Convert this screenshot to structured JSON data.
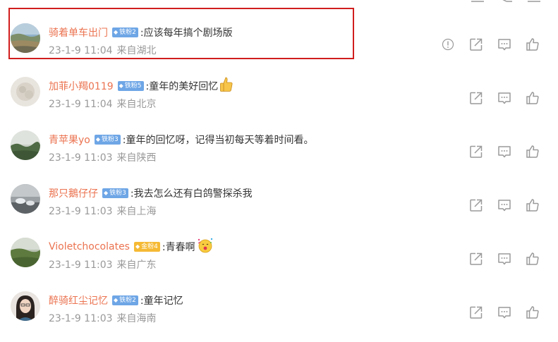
{
  "colors": {
    "username": "#eb7350",
    "meta": "#999999",
    "badge_blue": "#6ea6e6",
    "badge_gold": "#f5b934",
    "highlight_border": "#d11e1e",
    "icon": "#9a9a9a"
  },
  "comments": [
    {
      "username": "骑着单车出门",
      "badge": "铁粉2",
      "badge_type": "blue",
      "text": ":应该每年搞个剧场版",
      "date": "23-1-9 11:04",
      "location": "来自湖北",
      "actions": [
        "report-icon",
        "share-icon",
        "reply-icon",
        "like-icon"
      ],
      "highlighted": true
    },
    {
      "username": "加菲小羯0119",
      "badge": "铁粉5",
      "badge_type": "blue",
      "text": ":童年的美好回忆",
      "emoji": "thumbs-up-emoji",
      "date": "23-1-9 11:04",
      "location": "来自北京",
      "actions": [
        "share-icon",
        "reply-icon",
        "like-icon"
      ]
    },
    {
      "username": "青苹果yo",
      "badge": "铁粉3",
      "badge_type": "blue",
      "text": ":童年的回忆呀，记得当初每天等着时间看。",
      "date": "23-1-9 11:03",
      "location": "来自陕西",
      "actions": [
        "share-icon",
        "reply-icon",
        "like-icon"
      ]
    },
    {
      "username": "那只鵝仔仔",
      "badge": "铁粉3",
      "badge_type": "blue",
      "text": ":我去怎么还有白鸽警探杀我",
      "date": "23-1-9 11:03",
      "location": "来自上海",
      "actions": [
        "share-icon",
        "reply-icon",
        "like-icon"
      ]
    },
    {
      "username": "Violetchocolates",
      "badge": "金粉4",
      "badge_type": "gold",
      "text": ":青春啊",
      "emoji": "party-face-emoji",
      "date": "23-1-9 11:03",
      "location": "来自广东",
      "actions": [
        "share-icon",
        "reply-icon",
        "like-icon"
      ]
    },
    {
      "username": "醉骑红尘记忆",
      "badge": "铁粉2",
      "badge_type": "blue",
      "text": ":童年记忆",
      "date": "23-1-9 11:03",
      "location": "来自海南",
      "actions": [
        "share-icon",
        "reply-icon",
        "like-icon"
      ]
    }
  ]
}
